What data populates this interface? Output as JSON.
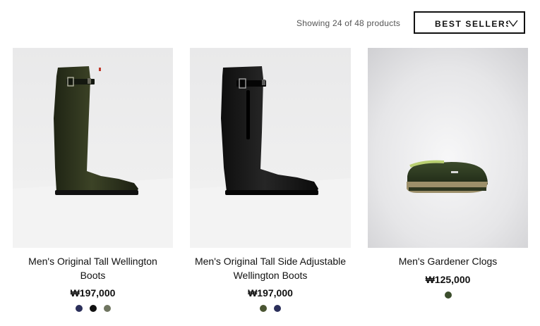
{
  "toolbar": {
    "count_text": "Showing 24 of 48 products",
    "sort_label": "BEST SELLERS",
    "sort_icon": "chevron-down-icon"
  },
  "products": [
    {
      "image": "green-tall-wellington-boot",
      "title": "Men's Original Tall Wellington Boots",
      "price": "₩197,000",
      "swatches": [
        "#2b2f5a",
        "#111111",
        "#6f7560"
      ]
    },
    {
      "image": "black-tall-side-adjustable-boot",
      "title": "Men's Original Tall Side Adjustable Wellington Boots",
      "price": "₩197,000",
      "swatches": [
        "#4a5532",
        "#2b2f5a"
      ]
    },
    {
      "image": "green-gardener-clog",
      "title": "Men's Gardener Clogs",
      "price": "₩125,000",
      "swatches": [
        "#3b4d2c"
      ]
    }
  ]
}
